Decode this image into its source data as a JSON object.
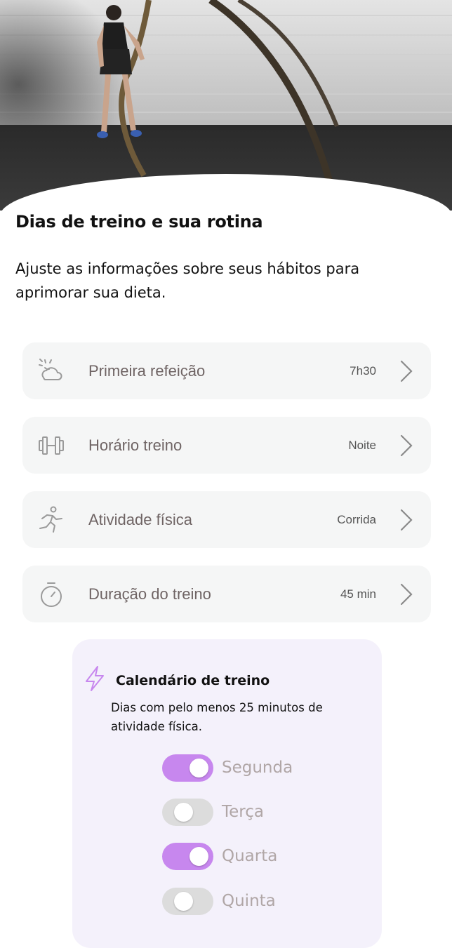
{
  "header": {
    "title": "Dias de treino e sua rotina",
    "subtitle": "Ajuste as informações sobre seus hábitos para aprimorar sua dieta."
  },
  "settings": [
    {
      "icon": "sun-cloud-icon",
      "label": "Primeira refeição",
      "value": "7h30"
    },
    {
      "icon": "dumbbell-icon",
      "label": "Horário treino",
      "value": "Noite"
    },
    {
      "icon": "running-icon",
      "label": "Atividade física",
      "value": "Corrida"
    },
    {
      "icon": "stopwatch-icon",
      "label": "Duração do treino",
      "value": "45 min"
    }
  ],
  "calendar": {
    "icon": "lightning-icon",
    "title": "Calendário de treino",
    "description": "Dias com pelo menos 25 minutos de atividade física.",
    "days": [
      {
        "label": "Segunda",
        "enabled": true
      },
      {
        "label": "Terça",
        "enabled": false
      },
      {
        "label": "Quarta",
        "enabled": true
      },
      {
        "label": "Quinta",
        "enabled": false
      }
    ]
  },
  "colors": {
    "accent": "#c787ee",
    "toggle_off": "#dcdcdc",
    "card_background": "#f4f1fb",
    "row_background": "#f5f6f6"
  }
}
